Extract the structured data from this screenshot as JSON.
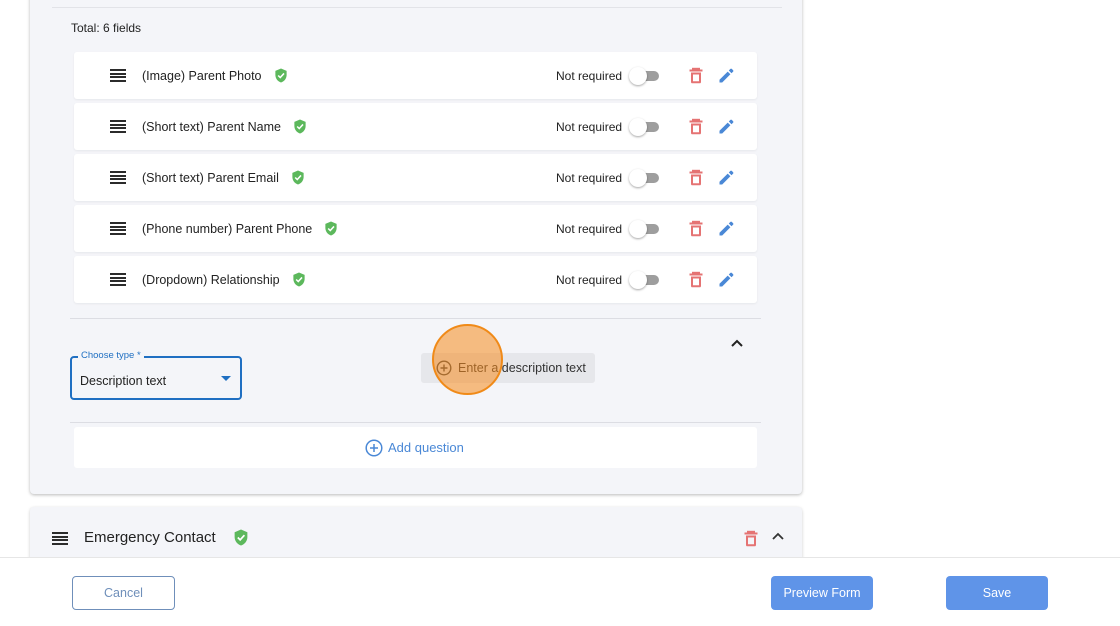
{
  "section": {
    "total_label": "Total: 6 fields",
    "fields": [
      {
        "title": "(Image) Parent Photo",
        "required_label": "Not required",
        "required": false
      },
      {
        "title": "(Short text) Parent Name",
        "required_label": "Not required",
        "required": false
      },
      {
        "title": "(Short text) Parent Email",
        "required_label": "Not required",
        "required": false
      },
      {
        "title": "(Phone number) Parent Phone",
        "required_label": "Not required",
        "required": false
      },
      {
        "title": "(Dropdown) Relationship",
        "required_label": "Not required",
        "required": false
      }
    ],
    "new_question": {
      "type_label": "Choose type *",
      "type_value": "Description text",
      "description_button": "Enter a description text"
    },
    "add_question": "Add question"
  },
  "next_section": {
    "title": "Emergency Contact"
  },
  "footer": {
    "cancel": "Cancel",
    "preview": "Preview Form",
    "save": "Save"
  },
  "colors": {
    "verified": "#5cb85c",
    "delete": "#e57373",
    "edit": "#4a88d6",
    "accent": "#1f6fc2",
    "primary_button": "#5f94e8"
  },
  "icons": {
    "drag": "drag-handle-icon",
    "verified": "verified-shield-icon",
    "delete": "trash-icon",
    "edit": "pencil-icon",
    "collapse": "chevron-up-icon",
    "add": "add-circle-icon"
  }
}
